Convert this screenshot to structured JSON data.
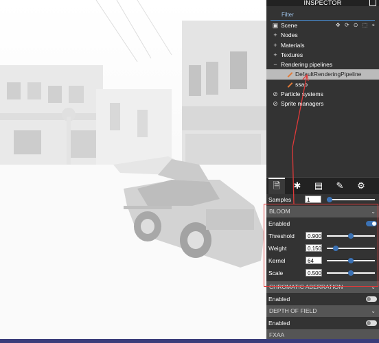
{
  "inspector": {
    "title": "INSPECTOR",
    "filter_placeholder": "Filter",
    "tree": {
      "scene": "Scene",
      "scene_tools": "✥ ⟳ ⊙ ⬚   ⌖",
      "items": [
        {
          "icon": "+",
          "label": "Nodes"
        },
        {
          "icon": "+",
          "label": "Materials"
        },
        {
          "icon": "+",
          "label": "Textures"
        },
        {
          "icon": "−",
          "label": "Rendering pipelines"
        }
      ],
      "pipelines": [
        "DefaultRenderingPipeline",
        "ssao"
      ],
      "other": [
        "Particle systems",
        "Sprite managers"
      ]
    },
    "tabs": [
      "file-icon",
      "bug-icon",
      "stats-icon",
      "wrench-icon",
      "gear-icon"
    ],
    "samples": {
      "label": "Samples",
      "value": "1"
    },
    "bloom": {
      "header": "BLOOM",
      "enabled_label": "Enabled",
      "enabled": true,
      "threshold": {
        "label": "Threshold",
        "value": "0.900",
        "level": 0.5
      },
      "weight": {
        "label": "Weight",
        "value": "0.150",
        "level": 0.15
      },
      "kernel": {
        "label": "Kernel",
        "value": "64",
        "level": 0.5
      },
      "scale": {
        "label": "Scale",
        "value": "0.500",
        "level": 0.5
      }
    },
    "chromatic": {
      "header": "CHROMATIC ABERRATION",
      "enabled_label": "Enabled",
      "enabled": false
    },
    "dof": {
      "header": "DEPTH OF FIELD",
      "enabled_label": "Enabled",
      "enabled": false
    },
    "fxaa": {
      "header": "FXAA"
    }
  },
  "colors": {
    "accent": "#3b72b5",
    "highlight": "#e03a3a",
    "panel": "#333333",
    "section": "#555555"
  }
}
